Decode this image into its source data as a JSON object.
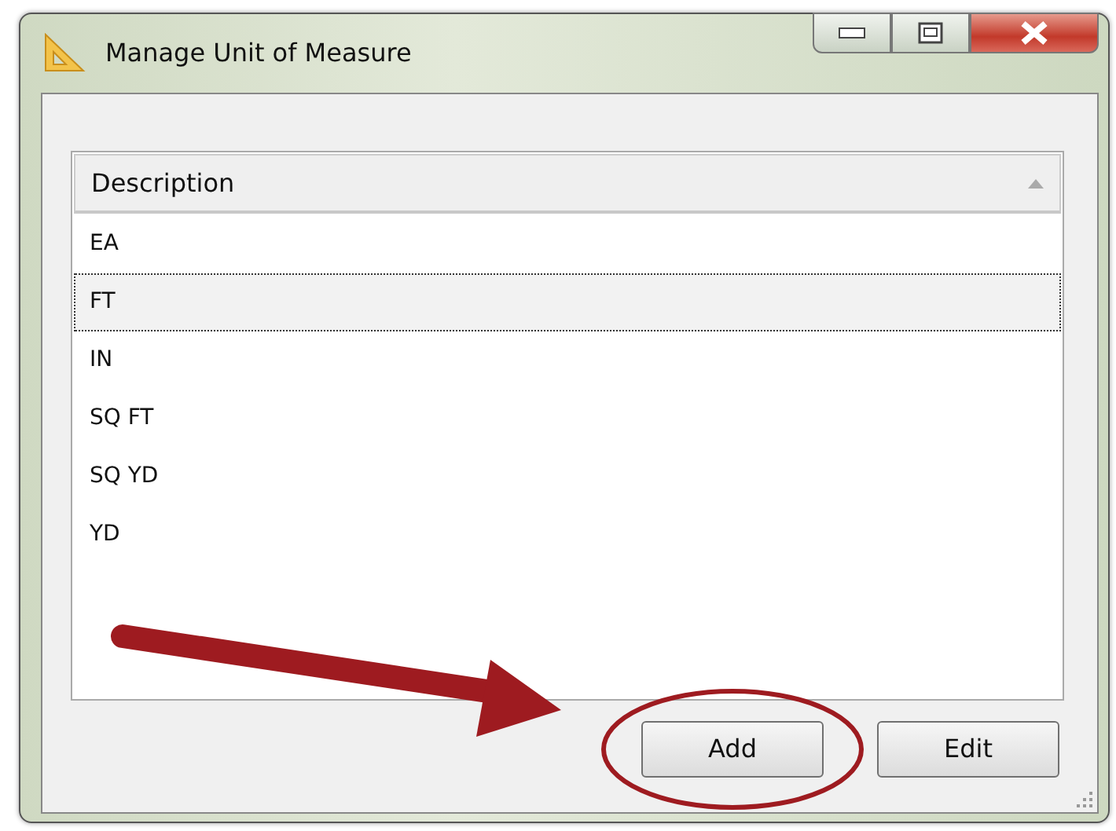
{
  "window": {
    "title": "Manage Unit of Measure"
  },
  "table": {
    "columns": [
      {
        "label": "Description",
        "sort_ascending": true
      }
    ],
    "rows": [
      {
        "description": "EA",
        "selected": false
      },
      {
        "description": "FT",
        "selected": true
      },
      {
        "description": "IN",
        "selected": false
      },
      {
        "description": "SQ FT",
        "selected": false
      },
      {
        "description": "SQ YD",
        "selected": false
      },
      {
        "description": "YD",
        "selected": false
      }
    ]
  },
  "buttons": [
    {
      "label": "Add",
      "highlighted": true
    },
    {
      "label": "Edit",
      "highlighted": false
    }
  ]
}
